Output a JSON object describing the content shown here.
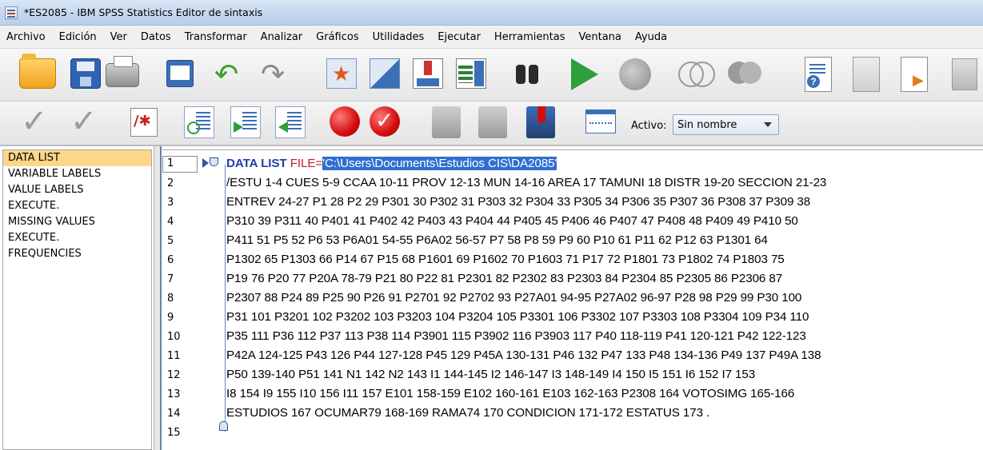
{
  "window": {
    "title": "*ES2085 - IBM SPSS Statistics Editor de sintaxis"
  },
  "menu": [
    "Archivo",
    "Edición",
    "Ver",
    "Datos",
    "Transformar",
    "Analizar",
    "Gráficos",
    "Utilidades",
    "Ejecutar",
    "Herramientas",
    "Ventana",
    "Ayuda"
  ],
  "toolbar": {
    "icons": [
      "open-icon",
      "save-icon",
      "print-icon",
      "dialog-recall-icon",
      "undo-icon",
      "redo-icon",
      "goto-case-icon",
      "goto-variable-icon",
      "insert-case-icon",
      "insert-variable-icon",
      "find-icon",
      "run-icon",
      "stop-icon",
      "venn-icon",
      "venn-filled-icon",
      "syntax-help-icon",
      "document-icon",
      "document-run-icon",
      "toolbar-end-icon"
    ],
    "icons2": [
      "validate-icon",
      "validate-all-icon",
      "comment-icon",
      "indent-icon",
      "outdent-right-icon",
      "outdent-left-icon",
      "breakpoint-icon",
      "breakpoint-check-icon",
      "bookmark-icon",
      "bookmark-next-icon",
      "bookmark-toggle-icon",
      "window-icon"
    ],
    "activo_label": "Activo:",
    "activo_value": "Sin nombre"
  },
  "navigation": {
    "items": [
      "DATA LIST",
      "VARIABLE LABELS",
      "VALUE LABELS",
      "EXECUTE.",
      "MISSING VALUES",
      "EXECUTE.",
      "FREQUENCIES"
    ]
  },
  "editor": {
    "line_numbers": [
      "1",
      "2",
      "3",
      "4",
      "5",
      "6",
      "7",
      "8",
      "9",
      "10",
      "11",
      "12",
      "13",
      "14",
      "15"
    ],
    "line1": {
      "keyword": "DATA LIST",
      "subcommand": "FILE=",
      "string": "'C:\\Users\\Documents\\Estudios CIS\\DA2085'"
    },
    "lines": [
      "/ESTU 1-4 CUES 5-9 CCAA 10-11 PROV 12-13 MUN 14-16 AREA 17 TAMUNI 18 DISTR 19-20 SECCION 21-23",
      "ENTREV 24-27 P1 28 P2 29 P301 30 P302 31 P303 32 P304 33 P305 34 P306 35 P307 36 P308 37 P309 38",
      "P310 39 P311 40 P401 41 P402 42 P403 43 P404 44 P405 45 P406 46 P407 47 P408 48 P409 49 P410 50",
      "P411 51 P5 52 P6 53 P6A01 54-55 P6A02 56-57 P7 58 P8 59 P9 60 P10 61 P11 62 P12 63 P1301 64",
      "P1302 65 P1303 66 P14 67 P15 68 P1601 69 P1602 70 P1603 71 P17 72 P1801 73 P1802 74 P1803 75",
      "P19 76 P20 77 P20A 78-79 P21 80 P22 81 P2301 82 P2302 83 P2303 84 P2304 85 P2305 86 P2306 87",
      "P2307 88 P24 89 P25 90 P26 91 P2701 92 P2702 93 P27A01 94-95 P27A02 96-97 P28 98 P29 99 P30 100",
      "P31 101 P3201 102 P3202 103 P3203 104 P3204 105 P3301 106 P3302 107 P3303 108 P3304 109 P34 110",
      "P35 111 P36 112 P37 113 P38 114 P3901 115 P3902 116 P3903 117 P40 118-119 P41 120-121 P42 122-123",
      "P42A 124-125 P43 126 P44 127-128 P45 129 P45A 130-131 P46 132 P47 133 P48 134-136 P49 137 P49A 138",
      "P50 139-140 P51 141 N1 142 N2 143 I1 144-145 I2 146-147 I3 148-149 I4 150 I5 151 I6 152 I7 153",
      "I8 154 I9 155 I10 156 I11 157 E101 158-159 E102 160-161 E103 162-163 P2308 164 VOTOSIMG 165-166",
      "ESTUDIOS 167 OCUMAR79 168-169 RAMA74 170 CONDICION 171-172 ESTATUS 173 ."
    ]
  }
}
